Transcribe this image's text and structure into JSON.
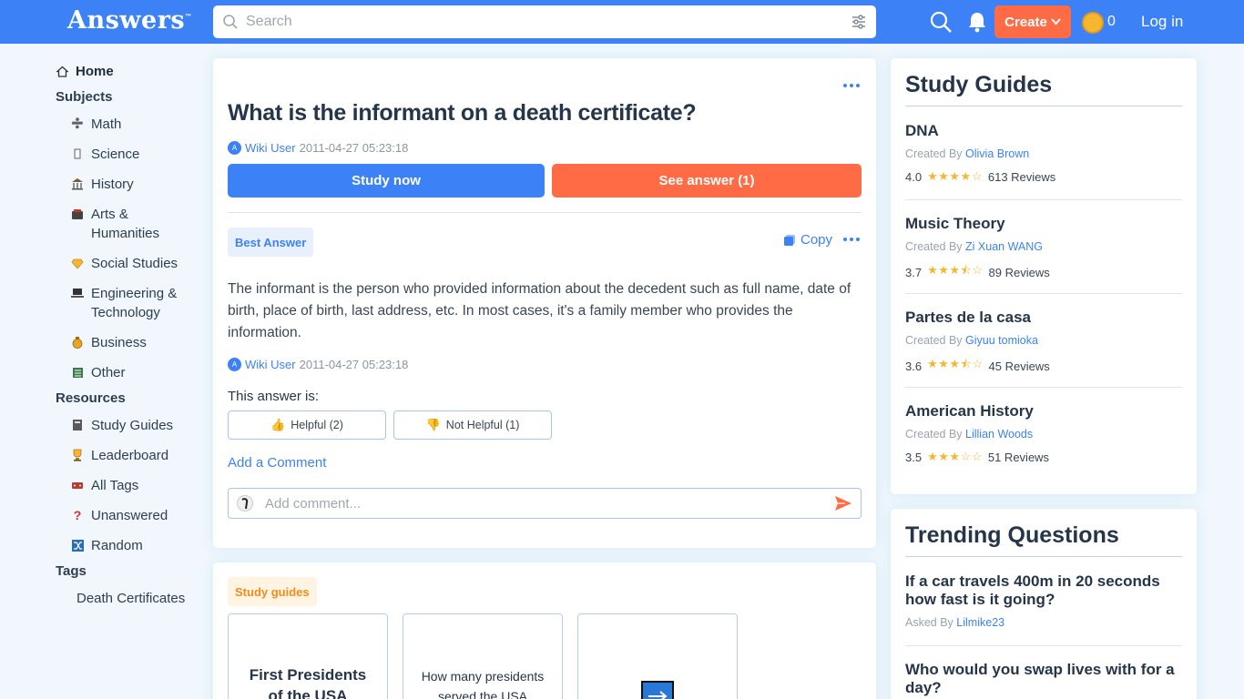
{
  "header": {
    "logo": "Answers",
    "logo_tm": "™",
    "search_placeholder": "Search",
    "create_label": "Create",
    "coins": "0",
    "login_label": "Log in"
  },
  "sidebar": {
    "home": "Home",
    "subjects_heading": "Subjects",
    "subjects": [
      {
        "label": "Math",
        "icon": "math-icon"
      },
      {
        "label": "Science",
        "icon": "science-icon"
      },
      {
        "label": "History",
        "icon": "history-icon"
      },
      {
        "label": "Arts & Humanities",
        "icon": "arts-icon"
      },
      {
        "label": "Social Studies",
        "icon": "social-studies-icon"
      },
      {
        "label": "Engineering & Technology",
        "icon": "engineering-icon"
      },
      {
        "label": "Business",
        "icon": "business-icon"
      },
      {
        "label": "Other",
        "icon": "other-icon"
      }
    ],
    "resources_heading": "Resources",
    "resources": [
      {
        "label": "Study Guides",
        "icon": "study-guides-icon"
      },
      {
        "label": "Leaderboard",
        "icon": "trophy-icon"
      },
      {
        "label": "All Tags",
        "icon": "tags-icon"
      },
      {
        "label": "Unanswered",
        "icon": "question-icon"
      },
      {
        "label": "Random",
        "icon": "shuffle-icon"
      }
    ],
    "tags_heading": "Tags",
    "tags": [
      "Death Certificates"
    ]
  },
  "question": {
    "title": "What is the informant on a death certificate?",
    "author": "Wiki User",
    "timestamp": "2011-04-27 05:23:18",
    "study_now": "Study now",
    "see_answer": "See answer (1)"
  },
  "answer": {
    "badge": "Best Answer",
    "copy_label": "Copy",
    "text": "The informant is the person who provided information about the decedent such as full name, date of birth, place of birth, last address, etc. In most cases, it's a family member who provides the information.",
    "author": "Wiki User",
    "timestamp": "2011-04-27 05:23:18",
    "rating_prompt": "This answer is:",
    "helpful": "Helpful (2)",
    "not_helpful": "Not Helpful (1)",
    "add_comment": "Add a Comment",
    "comment_placeholder": "Add comment..."
  },
  "study_guides_section": {
    "badge": "Study guides",
    "cards": [
      "First Presidents of the USA",
      "How many presidents served the USA"
    ]
  },
  "right": {
    "study_guides_title": "Study Guides",
    "guides": [
      {
        "name": "DNA",
        "by_prefix": "Created By",
        "creator": "Olivia Brown",
        "rating": "4.0",
        "stars": "★★★★☆",
        "reviews": "613 Reviews"
      },
      {
        "name": "Music Theory",
        "by_prefix": "Created By",
        "creator": "Zi Xuan WANG",
        "rating": "3.7",
        "stars": "★★★⯪☆",
        "reviews": "89 Reviews"
      },
      {
        "name": "Partes de la casa",
        "by_prefix": "Created By",
        "creator": "Giyuu tomioka",
        "rating": "3.6",
        "stars": "★★★⯪☆",
        "reviews": "45 Reviews"
      },
      {
        "name": "American History",
        "by_prefix": "Created By",
        "creator": "Lillian Woods",
        "rating": "3.5",
        "stars": "★★★☆☆",
        "reviews": "51 Reviews"
      }
    ],
    "trending_title": "Trending Questions",
    "trending": [
      {
        "q": "If a car travels 400m in 20 seconds how fast is it going?",
        "asked_prefix": "Asked By",
        "asker": "Lilmike23"
      },
      {
        "q": "Who would you swap lives with for a day?"
      }
    ]
  },
  "colors": {
    "brand_blue": "#3c82f6",
    "accent_orange": "#ff6b45",
    "star_gold": "#f5b731"
  }
}
